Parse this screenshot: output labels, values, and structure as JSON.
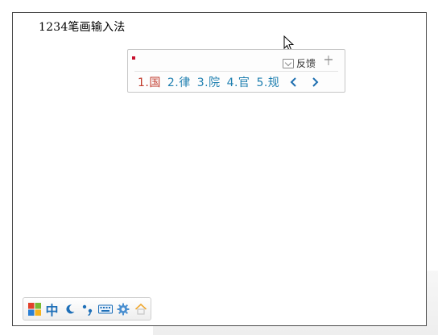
{
  "document": {
    "text": "1234笔画输入法"
  },
  "ime_popup": {
    "feedback_label": "反馈",
    "candidates": [
      "1.国",
      "2.律",
      "3.院",
      "4.官",
      "5.规"
    ]
  },
  "ime_toolbar": {
    "lang_label": "中"
  },
  "colors": {
    "candidate": "#1e7fb0",
    "candidate_active": "#c0392b",
    "brand_blue": "#1d6fb8"
  },
  "icons": [
    "mouse-pointer-icon",
    "feedback-icon",
    "pin-icon",
    "prev-page-icon",
    "next-page-icon",
    "windows-logo-icon",
    "moon-icon",
    "punctuation-icon",
    "keyboard-icon",
    "settings-gear-icon",
    "home-icon"
  ]
}
